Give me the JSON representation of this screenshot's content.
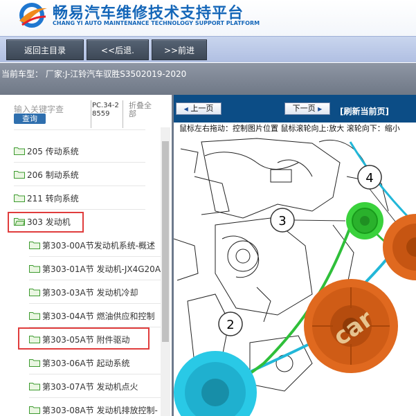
{
  "header": {
    "title": "畅易汽车维修技术支持平台",
    "subtitle": "CHANG YI AUTO MAINTENANCE TECHNOLOGY SUPPORT PLATFORM",
    "logo_icon": "cy-swoosh-logo"
  },
  "nav": {
    "home_label": "返回主目录",
    "back_label": "<<后退.",
    "forward_label": ">>前进"
  },
  "status": {
    "current_model": "当前车型：  厂家:J-江铃汽车驭胜S3502019-2020"
  },
  "left_panel": {
    "search_placeholder": "输入关键字查",
    "query_label": "查询",
    "pc_code": "PC.34-28559",
    "collapse_label": "折叠全部",
    "tree_items": [
      {
        "label": "205 传动系统"
      },
      {
        "label": "206 制动系统"
      },
      {
        "label": "211 转向系统"
      },
      {
        "label": "303 发动机"
      },
      {
        "label": "第303-00A节发动机系统-概述"
      },
      {
        "label": "第303-01A节 发动机-JX4G20A"
      },
      {
        "label": "第303-03A节 发动机冷却"
      },
      {
        "label": "第303-04A节 燃油供应和控制"
      },
      {
        "label": "第303-05A节 附件驱动"
      },
      {
        "label": "第303-06A节 起动系统"
      },
      {
        "label": "第303-07A节 发动机点火"
      },
      {
        "label": "第303-08A节 发动机排放控制-"
      }
    ]
  },
  "viewer": {
    "prev_label": "上一页",
    "next_label": "下一页",
    "refresh_label": "[刷新当前页]",
    "hint": "鼠标左右拖动：控制图片位置 鼠标滚轮向上:放大  滚轮向下：缩小",
    "callouts": [
      "2",
      "3",
      "4"
    ],
    "watermark": "car"
  },
  "colors": {
    "brand_blue": "#1466b8",
    "highlight_red": "#e03c3c",
    "pulley_orange": "#e0691f",
    "belt_green": "#2fbf3a",
    "belt_cyan": "#22b7d8"
  }
}
